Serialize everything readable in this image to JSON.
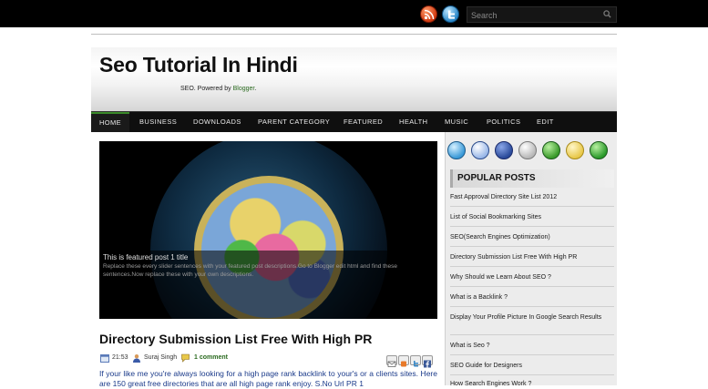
{
  "topbar": {
    "search_placeholder": "Search"
  },
  "header": {
    "site_title": "Seo Tutorial In Hindi",
    "site_desc_prefix": "SEO. Powered by ",
    "site_desc_link": "Blogger",
    "site_desc_suffix": "."
  },
  "nav": {
    "items": [
      "HOME",
      "BUSINESS",
      "DOWNLOADS",
      "PARENT CATEGORY",
      "FEATURED",
      "HEALTH",
      "MUSIC",
      "POLITICS",
      "EDIT"
    ]
  },
  "slider": {
    "caption_title": "This is featured post 1 title",
    "caption_desc": "Replace these every slider sentences with your featured post descriptions.Go to Blogger edit html and find these sentences.Now replace these with your own descriptions."
  },
  "post": {
    "title": "Directory Submission List Free With High PR",
    "time": "21:53",
    "author": "Suraj Singh",
    "comments": "1 comment",
    "body": "If your like me you're always looking for a high page rank backlink to your's or a clients sites. Here are 150 great free directories that are all high page rank enjoy. S.No Url PR 1"
  },
  "sidebar": {
    "popular_title": "POPULAR POSTS",
    "popular_posts": [
      "Fast Approval Directory Site List 2012",
      "List of Social Bookmarking Sites",
      "SEO(Search Engines Optimization)",
      "Directory Submission List Free With High PR",
      "Why Should we Learn About SEO ?",
      "What is a Backlink ?",
      "Display Your Profile Picture In Google Search Results",
      "What is Seo ?",
      "SEO Guide for Designers",
      "How Search Engines Work ?"
    ]
  },
  "colors": {
    "accent_green": "#2a6a1f",
    "nav_bg": "#0f0f0f",
    "link_blue": "#1a3a8a"
  }
}
